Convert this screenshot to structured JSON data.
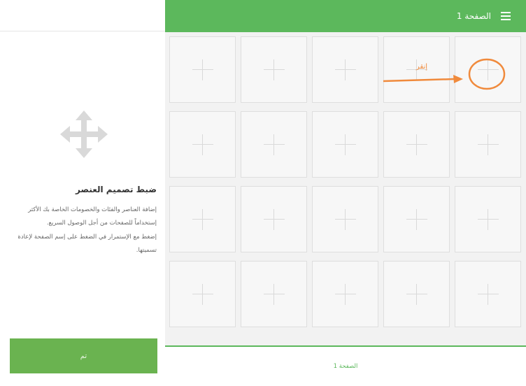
{
  "header": {
    "title": "الصفحة 1",
    "menu_icon": "hamburger-menu-icon",
    "color": "#5cb85c"
  },
  "left_panel": {
    "icon": "move-arrows-icon",
    "title": "ضبط تصميم العنصر",
    "description_1": "إضافة العناصر والفئات والخصومات الخاصة بك الأكثر إستخداماً للصفحات من أجل الوصول السريع.",
    "description_2": "إضغط مع الإستمرار في الضغط على إسم الصفحة لإعادة تسميتها.",
    "done_button": "تم"
  },
  "grid": {
    "rows": 4,
    "columns": 5,
    "cell_icon": "plus-icon"
  },
  "page_tabs": [
    {
      "label": "الصفحة 1",
      "active": true
    }
  ],
  "annotation": {
    "label": "إنقر",
    "color": "#f08a3c",
    "shapes": [
      "arrow",
      "circle"
    ]
  }
}
